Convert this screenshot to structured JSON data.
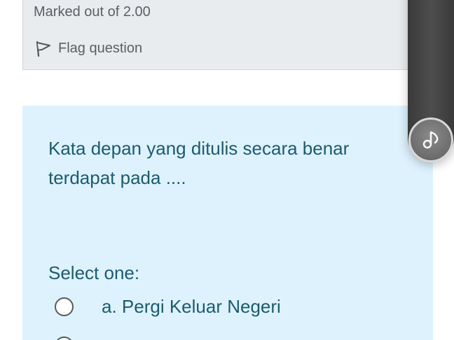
{
  "question_info": {
    "marked_text": "Marked out of 2.00",
    "flag_label": "Flag question"
  },
  "question": {
    "text": "Kata depan yang ditulis secara benar terdapat pada ....",
    "prompt": "Select one:",
    "options": [
      {
        "label": "a. Pergi Keluar Negeri",
        "selected": false
      },
      {
        "label": "",
        "selected": false
      }
    ]
  },
  "floating_toolbar": {
    "button_icon": "music-note-icon"
  },
  "colors": {
    "info_bg": "#e9ecef",
    "content_bg": "#def2fd",
    "question_text": "#1d5b6e",
    "meta_text": "#5b5f63"
  }
}
